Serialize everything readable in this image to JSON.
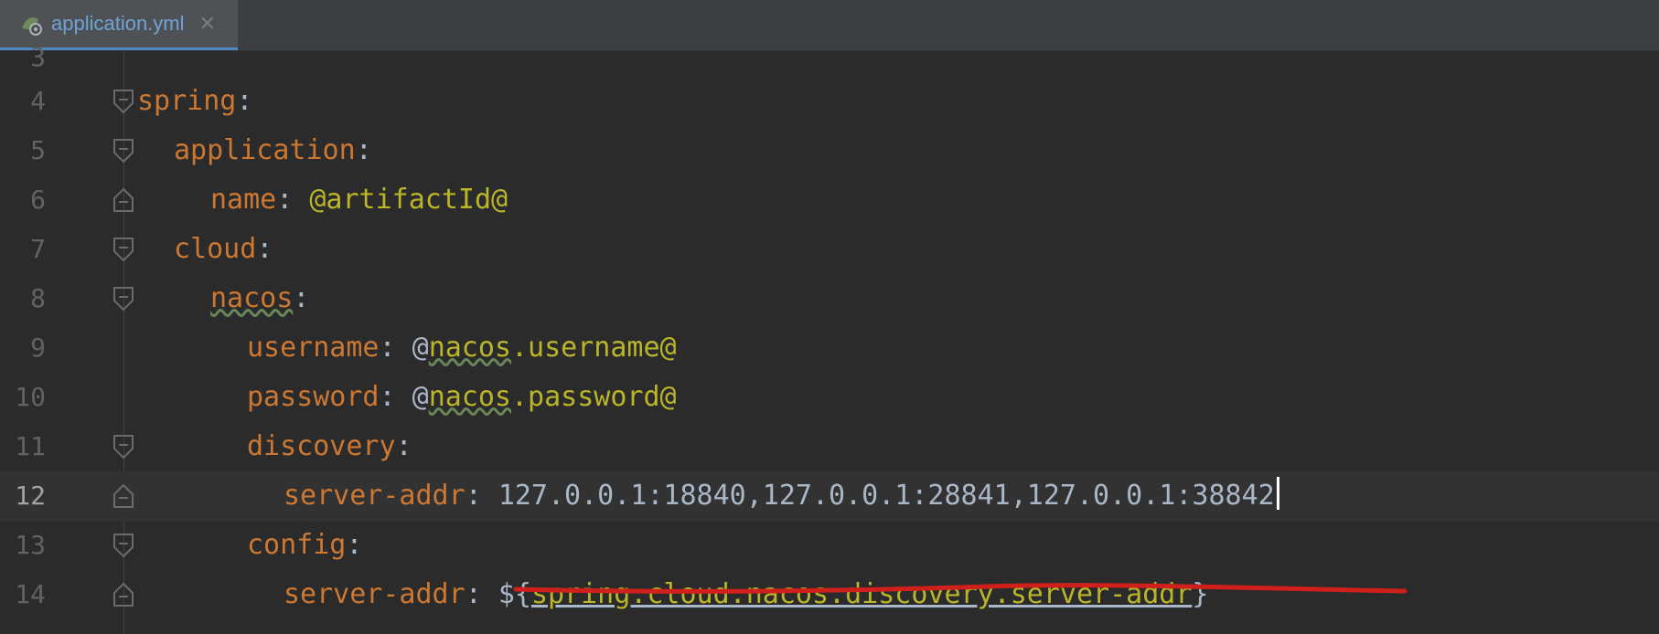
{
  "tab": {
    "filename": "application.yml",
    "close": "✕"
  },
  "lines": [
    {
      "num": "3"
    },
    {
      "num": "4",
      "key": "spring"
    },
    {
      "num": "5",
      "key": "application"
    },
    {
      "num": "6",
      "key": "name",
      "value": "@artifactId@"
    },
    {
      "num": "7",
      "key": "cloud"
    },
    {
      "num": "8",
      "key": "nacos"
    },
    {
      "num": "9",
      "key": "username",
      "value_prefix": "@",
      "value_ns": "nacos",
      "value_rest": ".username@"
    },
    {
      "num": "10",
      "key": "password",
      "value_prefix": "@",
      "value_ns": "nacos",
      "value_rest": ".password@"
    },
    {
      "num": "11",
      "key": "discovery"
    },
    {
      "num": "12",
      "key": "server-addr",
      "value": "127.0.0.1:18840,127.0.0.1:28841,127.0.0.1:38842"
    },
    {
      "num": "13",
      "key": "config"
    },
    {
      "num": "14",
      "key": "server-addr",
      "value_open": "${",
      "value_ref": "spring.cloud.nacos.discovery.server-addr",
      "value_close": "}"
    }
  ],
  "colors": {
    "key": "#cc7832",
    "value": "#a9b7c6",
    "annotation": "#bbb529",
    "highlight": "#d0201c"
  }
}
